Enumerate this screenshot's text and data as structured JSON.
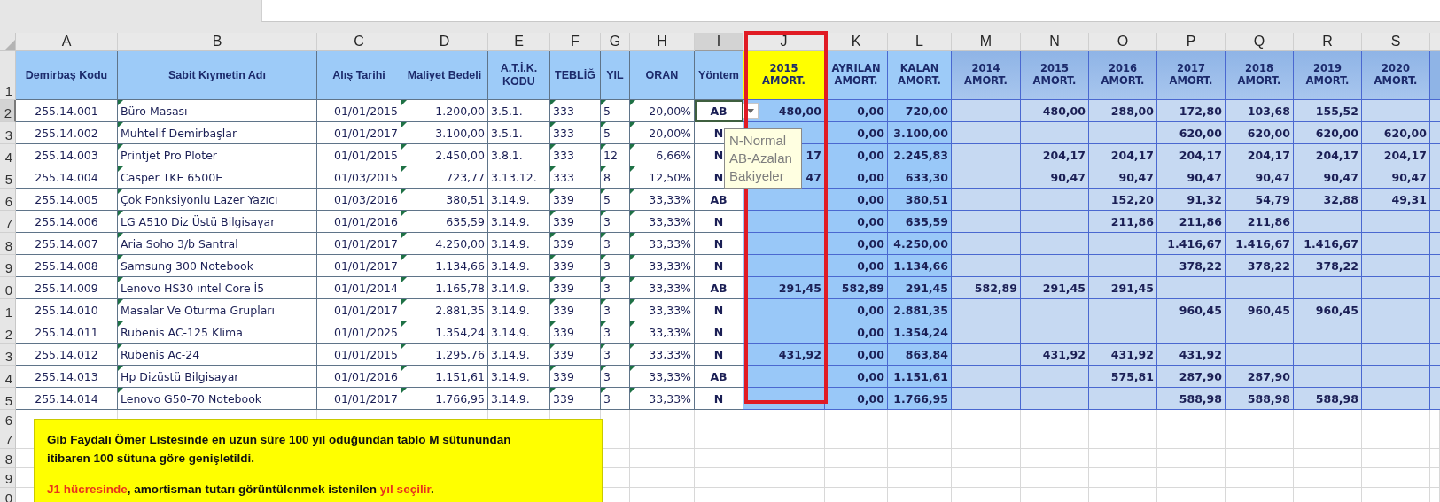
{
  "column_headers": [
    {
      "label": "A",
      "selected": false
    },
    {
      "label": "B",
      "selected": false
    },
    {
      "label": "C",
      "selected": false
    },
    {
      "label": "D",
      "selected": false
    },
    {
      "label": "E",
      "selected": false
    },
    {
      "label": "F",
      "selected": false
    },
    {
      "label": "G",
      "selected": false
    },
    {
      "label": "H",
      "selected": false
    },
    {
      "label": "I",
      "selected": true
    },
    {
      "label": "J",
      "selected": false
    },
    {
      "label": "K",
      "selected": false
    },
    {
      "label": "L",
      "selected": false
    },
    {
      "label": "M",
      "selected": false
    },
    {
      "label": "N",
      "selected": false
    },
    {
      "label": "O",
      "selected": false
    },
    {
      "label": "P",
      "selected": false
    },
    {
      "label": "Q",
      "selected": false
    },
    {
      "label": "R",
      "selected": false
    },
    {
      "label": "S",
      "selected": false
    }
  ],
  "table": {
    "header_row_number": "1",
    "dropdown": true,
    "columns": [
      {
        "title": [
          "Demirbaş Kodu"
        ],
        "kind": "code",
        "warning": false,
        "framed": false
      },
      {
        "title": [
          "Sabit Kıymetin Adı"
        ],
        "kind": "text",
        "warning": true,
        "framed": false
      },
      {
        "title": [
          "Alış Tarihi"
        ],
        "kind": "number",
        "warning": false,
        "framed": false
      },
      {
        "title": [
          "Maliyet Bedeli"
        ],
        "kind": "number",
        "warning": true,
        "framed": false
      },
      {
        "title": [
          "A.T.İ.K.",
          "KODU"
        ],
        "kind": "text",
        "warning": false,
        "framed": false
      },
      {
        "title": [
          "TEBLİĞ"
        ],
        "kind": "text",
        "warning": true,
        "framed": false
      },
      {
        "title": [
          "YIL"
        ],
        "kind": "text",
        "warning": true,
        "framed": false
      },
      {
        "title": [
          "ORAN"
        ],
        "kind": "number",
        "warning": true,
        "framed": false
      },
      {
        "title": [
          "Yöntem"
        ],
        "kind": "method",
        "warning": false,
        "framed": false
      },
      {
        "title": [
          "2015",
          "AMORT."
        ],
        "kind": "selected_year",
        "warning": false,
        "framed": true
      },
      {
        "title": [
          "AYRILAN",
          "AMORT."
        ],
        "kind": "total",
        "warning": false,
        "framed": false
      },
      {
        "title": [
          "KALAN",
          "AMORT."
        ],
        "kind": "total",
        "warning": false,
        "framed": false
      },
      {
        "title": [
          "2014",
          "AMORT."
        ],
        "kind": "year",
        "warning": false,
        "framed": false
      },
      {
        "title": [
          "2015",
          "AMORT."
        ],
        "kind": "year",
        "warning": false,
        "framed": false
      },
      {
        "title": [
          "2016",
          "AMORT."
        ],
        "kind": "year",
        "warning": false,
        "framed": false
      },
      {
        "title": [
          "2017",
          "AMORT."
        ],
        "kind": "year",
        "warning": false,
        "framed": false
      },
      {
        "title": [
          "2018",
          "AMORT."
        ],
        "kind": "year",
        "warning": false,
        "framed": false
      },
      {
        "title": [
          "2019",
          "AMORT."
        ],
        "kind": "year",
        "warning": false,
        "framed": false
      },
      {
        "title": [
          "2020",
          "AMORT."
        ],
        "kind": "year",
        "warning": false,
        "framed": false
      }
    ],
    "rows": [
      {
        "number": "2",
        "selected": true,
        "cells": [
          "255.14.001",
          "Büro Masası",
          "01/01/2015",
          "1.200,00",
          "3.5.1.",
          "333",
          "5",
          "20,00%",
          "AB",
          "480,00",
          "0,00",
          "720,00",
          null,
          "480,00",
          "288,00",
          "172,80",
          "103,68",
          "155,52",
          null
        ]
      },
      {
        "number": "3",
        "selected": false,
        "cells": [
          "255.14.002",
          "Muhtelif Demirbaşlar",
          "01/01/2017",
          "3.100,00",
          "3.5.1.",
          "333",
          "5",
          "20,00%",
          "N",
          null,
          "0,00",
          "3.100,00",
          null,
          null,
          null,
          "620,00",
          "620,00",
          "620,00",
          "620,00"
        ]
      },
      {
        "number": "4",
        "selected": false,
        "cells": [
          "255.14.003",
          "Printjet Pro Ploter",
          "01/01/2015",
          "2.450,00",
          "3.8.1.",
          "333",
          "12",
          "6,66%",
          "N",
          "17",
          "0,00",
          "2.245,83",
          null,
          "204,17",
          "204,17",
          "204,17",
          "204,17",
          "204,17",
          "204,17"
        ]
      },
      {
        "number": "5",
        "selected": false,
        "cells": [
          "255.14.004",
          "Casper TKE 6500E",
          "01/03/2015",
          "723,77",
          "3.13.12.",
          "333",
          "8",
          "12,50%",
          "N",
          "47",
          "0,00",
          "633,30",
          null,
          "90,47",
          "90,47",
          "90,47",
          "90,47",
          "90,47",
          "90,47"
        ]
      },
      {
        "number": "6",
        "selected": false,
        "cells": [
          "255.14.005",
          "Çok Fonksiyonlu Lazer Yazıcı",
          "01/03/2016",
          "380,51",
          "3.14.9.",
          "339",
          "5",
          "33,33%",
          "AB",
          null,
          "0,00",
          "380,51",
          null,
          null,
          "152,20",
          "91,32",
          "54,79",
          "32,88",
          "49,31"
        ]
      },
      {
        "number": "7",
        "selected": false,
        "cells": [
          "255.14.006",
          "LG A510 Diz Üstü Bilgisayar",
          "01/01/2016",
          "635,59",
          "3.14.9.",
          "339",
          "3",
          "33,33%",
          "N",
          null,
          "0,00",
          "635,59",
          null,
          null,
          "211,86",
          "211,86",
          "211,86",
          null,
          null
        ]
      },
      {
        "number": "8",
        "selected": false,
        "cells": [
          "255.14.007",
          "Aria Soho 3/b Santral",
          "01/01/2017",
          "4.250,00",
          "3.14.9.",
          "339",
          "3",
          "33,33%",
          "N",
          null,
          "0,00",
          "4.250,00",
          null,
          null,
          null,
          "1.416,67",
          "1.416,67",
          "1.416,67",
          null
        ]
      },
      {
        "number": "9",
        "selected": false,
        "cells": [
          "255.14.008",
          "Samsung 300 Notebook",
          "01/01/2017",
          "1.134,66",
          "3.14.9.",
          "339",
          "3",
          "33,33%",
          "N",
          null,
          "0,00",
          "1.134,66",
          null,
          null,
          null,
          "378,22",
          "378,22",
          "378,22",
          null
        ]
      },
      {
        "number": "0",
        "selected": false,
        "cells": [
          "255.14.009",
          "Lenovo HS30 ıntel Core İ5",
          "01/01/2014",
          "1.165,78",
          "3.14.9.",
          "339",
          "3",
          "33,33%",
          "AB",
          "291,45",
          "582,89",
          "291,45",
          "582,89",
          "291,45",
          "291,45",
          null,
          null,
          null,
          null
        ]
      },
      {
        "number": "1",
        "selected": false,
        "cells": [
          "255.14.010",
          "Masalar Ve Oturma Grupları",
          "01/01/2017",
          "2.881,35",
          "3.14.9.",
          "339",
          "3",
          "33,33%",
          "N",
          null,
          "0,00",
          "2.881,35",
          null,
          null,
          null,
          "960,45",
          "960,45",
          "960,45",
          null
        ]
      },
      {
        "number": "2",
        "selected": false,
        "cells": [
          "255.14.011",
          "Rubenis AC-125 Klima",
          "01/01/2025",
          "1.354,24",
          "3.14.9.",
          "339",
          "3",
          "33,33%",
          "N",
          null,
          "0,00",
          "1.354,24",
          null,
          null,
          null,
          null,
          null,
          null,
          null
        ]
      },
      {
        "number": "3",
        "selected": false,
        "cells": [
          "255.14.012",
          "Rubenis Ac-24",
          "01/01/2015",
          "1.295,76",
          "3.14.9.",
          "339",
          "3",
          "33,33%",
          "N",
          "431,92",
          "0,00",
          "863,84",
          null,
          "431,92",
          "431,92",
          "431,92",
          null,
          null,
          null
        ]
      },
      {
        "number": "4",
        "selected": false,
        "cells": [
          "255.14.013",
          "Hp Dizüstü Bilgisayar",
          "01/01/2016",
          "1.151,61",
          "3.14.9.",
          "339",
          "3",
          "33,33%",
          "AB",
          null,
          "0,00",
          "1.151,61",
          null,
          null,
          "575,81",
          "287,90",
          "287,90",
          null,
          null
        ]
      },
      {
        "number": "5",
        "selected": false,
        "cells": [
          "255.14.014",
          "Lenovo G50-70 Notebook",
          "01/01/2017",
          "1.766,95",
          "3.14.9.",
          "339",
          "3",
          "33,33%",
          "N",
          null,
          "0,00",
          "1.766,95",
          null,
          null,
          null,
          "588,98",
          "588,98",
          "588,98",
          null
        ]
      }
    ],
    "empty_rows": [
      "6",
      "7",
      "8",
      "9",
      "0"
    ]
  },
  "tooltip": {
    "lines": [
      "N-Normal",
      "AB-Azalan",
      "Bakiyeler"
    ]
  },
  "note": {
    "paragraphs": [
      {
        "lines": [
          [
            {
              "text": "Gib Faydalı Ömer Listesinde en uzun süre 100 yıl oduğundan tablo M sütunundan",
              "emphasis": false
            }
          ],
          [
            {
              "text": "itibaren 100 sütuna göre genişletildi.",
              "emphasis": false
            }
          ]
        ]
      },
      {
        "lines": [
          [
            {
              "text": "J1 hücresinde",
              "emphasis": true
            },
            {
              "text": ", amortisman tutarı görüntülenmek istenilen ",
              "emphasis": false
            },
            {
              "text": "yıl seçilir",
              "emphasis": true
            },
            {
              "text": ".",
              "emphasis": false
            }
          ]
        ]
      }
    ]
  }
}
